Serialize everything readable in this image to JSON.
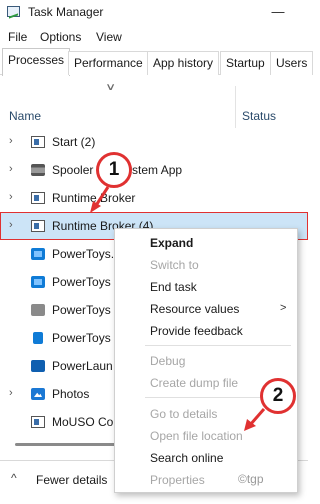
{
  "window": {
    "title": "Task Manager",
    "minimize_glyph": "—"
  },
  "menubar": [
    "File",
    "Options",
    "View"
  ],
  "tabs": [
    "Processes",
    "Performance",
    "App history",
    "Startup",
    "Users"
  ],
  "columns": {
    "name": "Name",
    "status": "Status"
  },
  "processes": [
    {
      "label": "Start (2)",
      "expand": true,
      "icon": "window-icon"
    },
    {
      "label": "Spooler SubSystem App",
      "expand": true,
      "icon": "printer-icon"
    },
    {
      "label": "Runtime Broker",
      "expand": true,
      "icon": "window-icon"
    },
    {
      "label": "Runtime Broker (4)",
      "expand": true,
      "icon": "window-icon",
      "selected": true
    },
    {
      "label": "PowerToys.",
      "expand": false,
      "icon": "app-icon"
    },
    {
      "label": "PowerToys",
      "expand": false,
      "icon": "app-icon"
    },
    {
      "label": "PowerToys",
      "expand": false,
      "icon": "keyboard-icon"
    },
    {
      "label": "PowerToys",
      "expand": false,
      "icon": "phone-icon"
    },
    {
      "label": "PowerLaun",
      "expand": false,
      "icon": "rocket-icon"
    },
    {
      "label": "Photos",
      "expand": true,
      "icon": "photos-icon"
    },
    {
      "label": "MoUSO Co",
      "expand": false,
      "icon": "window-icon"
    }
  ],
  "context_menu": {
    "items": [
      {
        "label": "Expand",
        "style": "bold"
      },
      {
        "label": "Switch to",
        "style": "disabled"
      },
      {
        "label": "End task",
        "style": "normal"
      },
      {
        "label": "Resource values",
        "style": "normal",
        "submenu": true
      },
      {
        "label": "Provide feedback",
        "style": "normal"
      },
      {
        "label": "Debug",
        "style": "disabled"
      },
      {
        "label": "Create dump file",
        "style": "disabled"
      },
      {
        "label": "Go to details",
        "style": "disabled"
      },
      {
        "label": "Open file location",
        "style": "disabled"
      },
      {
        "label": "Search online",
        "style": "normal"
      },
      {
        "label": "Properties",
        "style": "disabled"
      }
    ],
    "submenu_arrow": ">"
  },
  "footer": {
    "label": "Fewer details",
    "chevron": "^"
  },
  "callouts": [
    "1",
    "2"
  ],
  "watermark": "©tgp",
  "colors": {
    "selection": "#cce4f7",
    "callout_red": "#e03131",
    "disabled_text": "#a6a6a6"
  }
}
